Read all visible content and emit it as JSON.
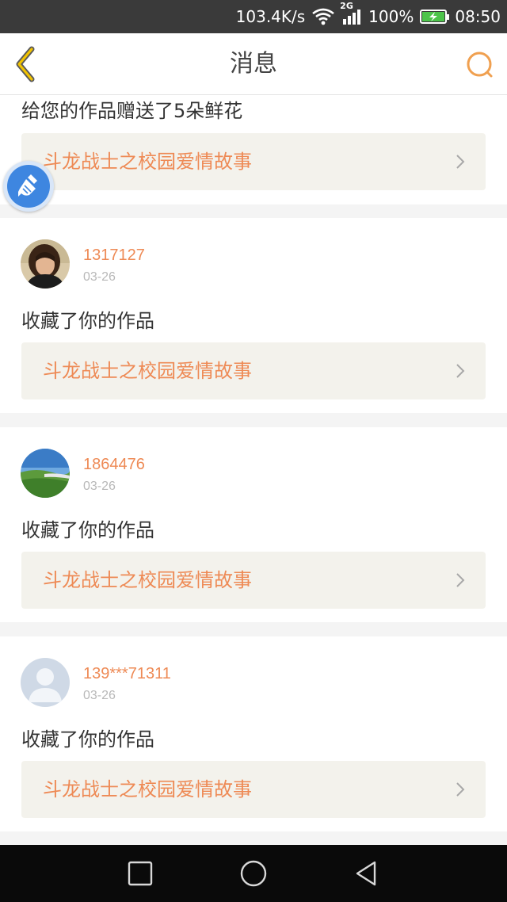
{
  "status_bar": {
    "speed": "103.4K/s",
    "network": "2G",
    "battery": "100%",
    "battery_level": 1.0,
    "time": "08:50"
  },
  "nav": {
    "title": "消息",
    "back_icon": "chevron-left-icon",
    "search_icon": "search-icon"
  },
  "partial_item": {
    "action": "给您的作品赠送了5朵鲜花",
    "work_title": "斗龙战士之校园爱情故事"
  },
  "messages": [
    {
      "username": "1317127",
      "date": "03-26",
      "action": "收藏了你的作品",
      "work_title": "斗龙战士之校园爱情故事",
      "avatar": "child-photo-avatar"
    },
    {
      "username": "1864476",
      "date": "03-26",
      "action": "收藏了你的作品",
      "work_title": "斗龙战士之校园爱情故事",
      "avatar": "landscape-photo-avatar"
    },
    {
      "username": "139***71311",
      "date": "03-26",
      "action": "收藏了你的作品",
      "work_title": "斗龙战士之校园爱情故事",
      "avatar": "default-user-avatar"
    }
  ],
  "colors": {
    "accent": "#ee8a55",
    "back_icon": "#e6b800",
    "search_icon": "#f0a050",
    "link_bg": "#f3f2ec"
  }
}
